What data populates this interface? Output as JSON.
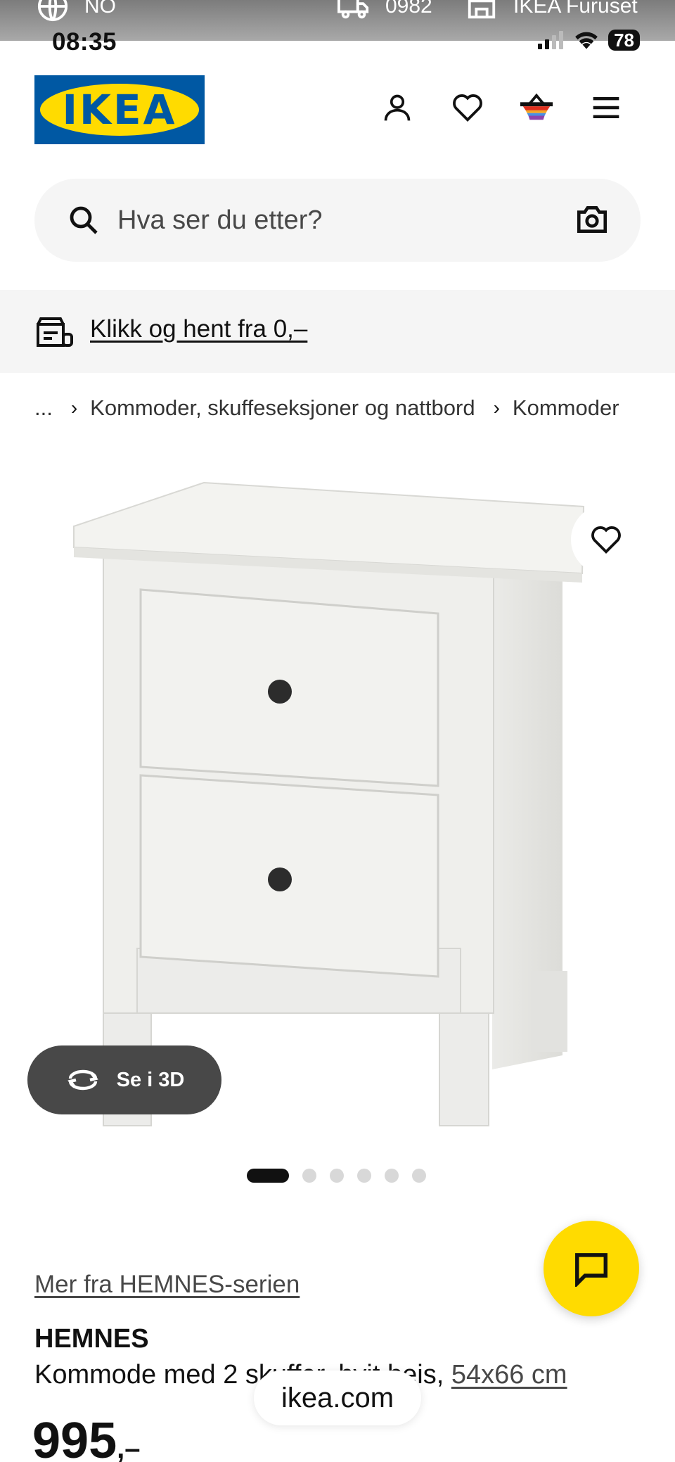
{
  "status_bar": {
    "time": "08:35",
    "battery": "78",
    "top_strip": {
      "locale": "NO",
      "postcode": "0982",
      "store": "IKEA Furuset"
    }
  },
  "header": {
    "logo_text": "IKEA",
    "icons": [
      "user-icon",
      "heart-icon",
      "basket-icon",
      "menu-icon"
    ]
  },
  "search": {
    "placeholder": "Hva ser du etter?"
  },
  "promo": {
    "text": "Klikk og hent fra 0,–"
  },
  "breadcrumb": {
    "ellipsis": "...",
    "items": [
      "Kommoder, skuffeseksjoner og nattbord",
      "Kommoder"
    ]
  },
  "gallery": {
    "view_3d_label": "Se i 3D",
    "dots_count": 6,
    "active_index": 0
  },
  "product": {
    "series_link": "Mer fra HEMNES-serien",
    "name": "HEMNES",
    "description": "Kommode med 2 skuffer, hvit beis,",
    "size": "54x66 cm",
    "price": "995",
    "price_suffix": ",–"
  },
  "browser": {
    "url": "ikea.com"
  },
  "colors": {
    "ikea_blue": "#0058a3",
    "ikea_yellow": "#ffdb00",
    "dark": "#111111"
  }
}
